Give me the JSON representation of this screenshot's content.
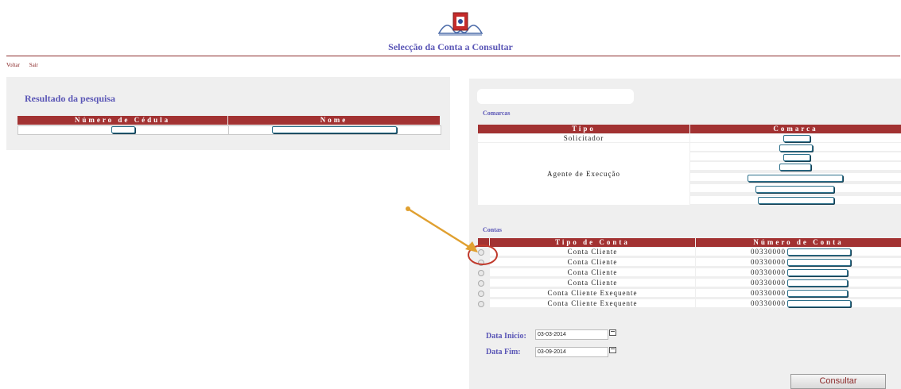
{
  "header": {
    "title": "Selecção da Conta a Consultar"
  },
  "nav": {
    "voltar": "Voltar",
    "sair": "Sair"
  },
  "search": {
    "title": "Resultado da pesquisa",
    "columns": [
      "Número de Cédula",
      "Nome"
    ]
  },
  "comarcas": {
    "label": "Comarcas",
    "columns": [
      "Tipo",
      "Comarca"
    ],
    "types": [
      "Solicitador",
      "Agente de Execução"
    ]
  },
  "contas": {
    "label": "Contas",
    "columns": [
      "Tipo de Conta",
      "Número de Conta"
    ],
    "rows": [
      {
        "tipo": "Conta Cliente",
        "numero": "00330000"
      },
      {
        "tipo": "Conta Cliente",
        "numero": "00330000"
      },
      {
        "tipo": "Conta Cliente",
        "numero": "00330000"
      },
      {
        "tipo": "Conta Cliente",
        "numero": "00330000"
      },
      {
        "tipo": "Conta Cliente Exequente",
        "numero": "00330000"
      },
      {
        "tipo": "Conta Cliente Exequente",
        "numero": "00330000"
      }
    ]
  },
  "dates": {
    "inicio_label": "Data Inicio:",
    "inicio_value": "03-03-2014",
    "fim_label": "Data Fim:",
    "fim_value": "03-09-2014"
  },
  "actions": {
    "consultar": "Consultar"
  },
  "colors": {
    "accent": "#a23232",
    "label": "#5a56b6",
    "highlight": "#c0392b",
    "arrow": "#e0a030"
  }
}
